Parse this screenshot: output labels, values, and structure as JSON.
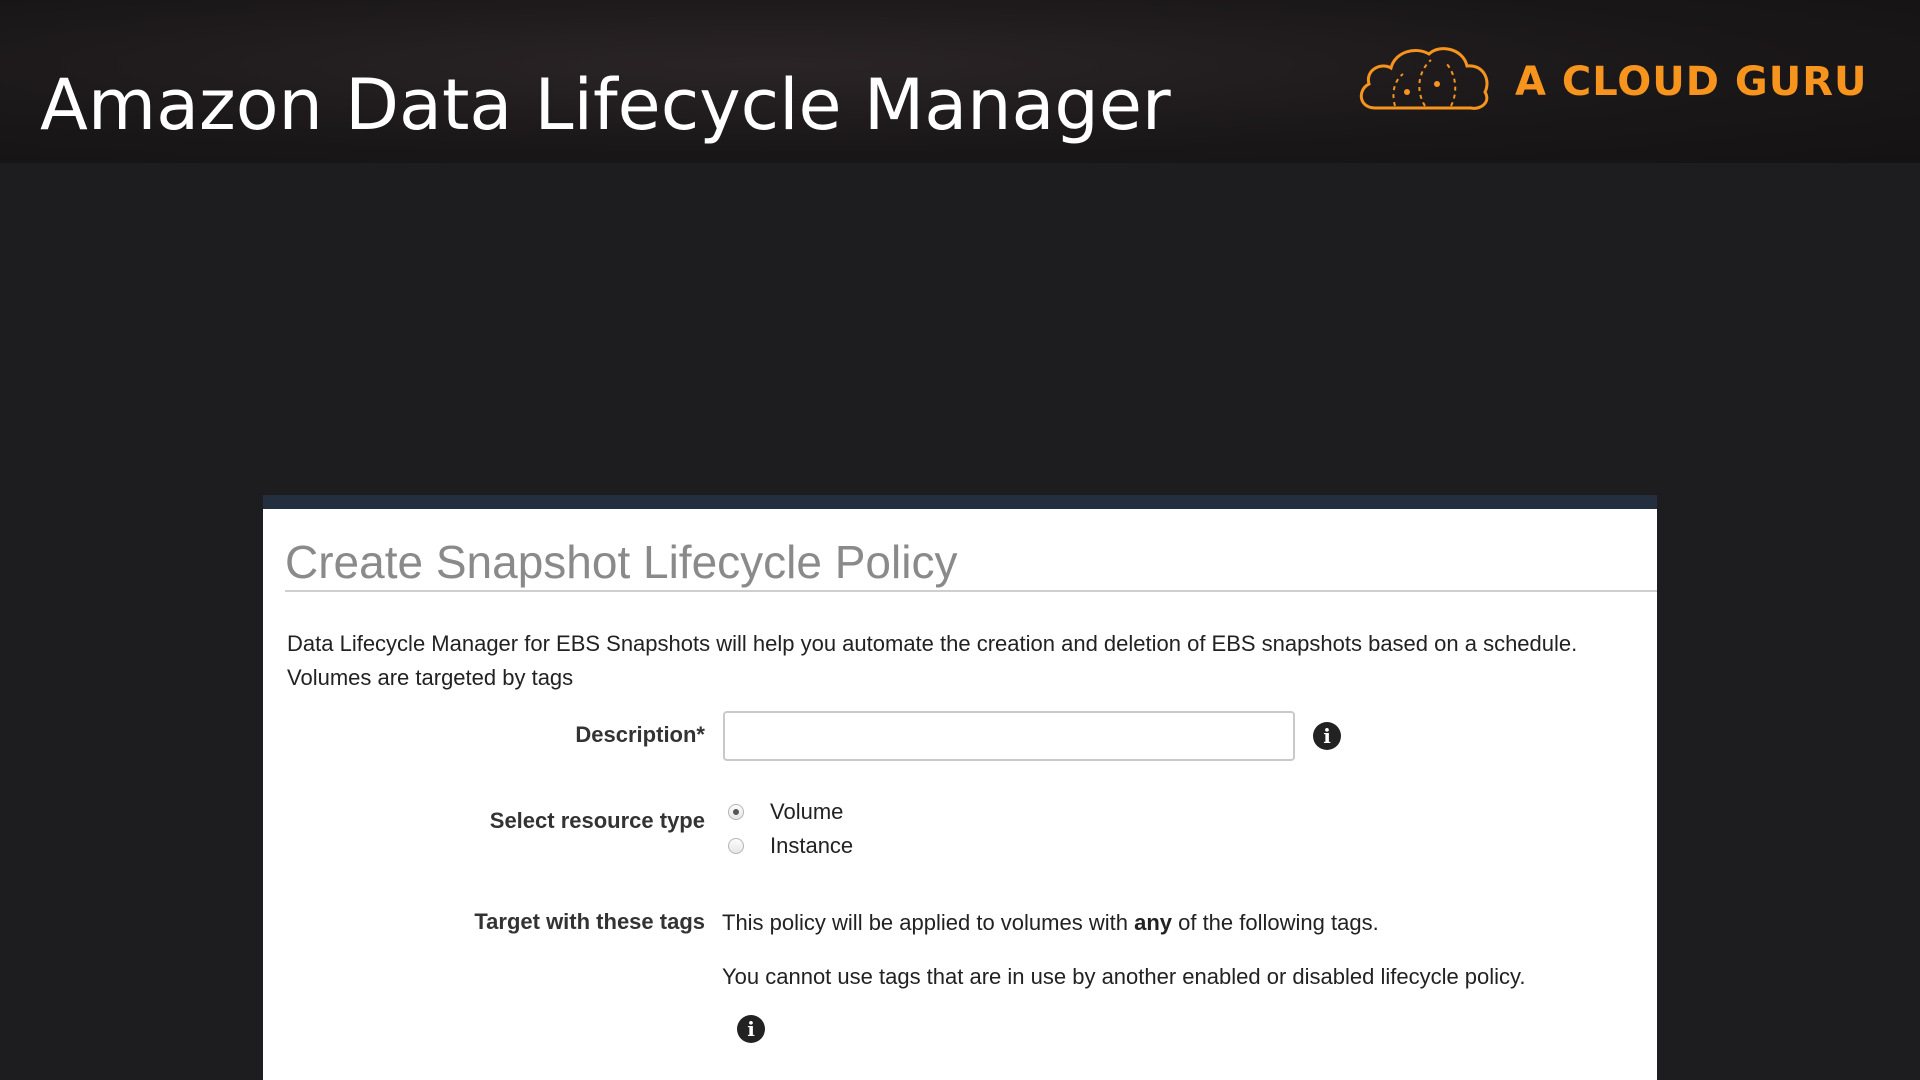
{
  "header": {
    "title": "Amazon Data Lifecycle Manager",
    "brand_name": "A CLOUD GURU",
    "brand_icon": "cloud-icon",
    "brand_color": "#f7941d"
  },
  "panel": {
    "title": "Create Snapshot Lifecycle Policy",
    "intro_line1": "Data Lifecycle Manager for EBS Snapshots will help you automate the creation and deletion of EBS snapshots based on a schedule.",
    "intro_line2": "Volumes are targeted by tags",
    "description": {
      "label": "Description*",
      "value": "",
      "info_icon": "info-icon"
    },
    "resource_type": {
      "label": "Select resource type",
      "options": [
        {
          "label": "Volume",
          "selected": true
        },
        {
          "label": "Instance",
          "selected": false
        }
      ]
    },
    "target_tags": {
      "label": "Target with these tags",
      "line1_before": "This policy will be applied to volumes with ",
      "line1_bold": "any",
      "line1_after": " of the following tags.",
      "line2": "You cannot use tags that are in use by another enabled or disabled lifecycle policy.",
      "info_icon": "info-icon"
    }
  }
}
